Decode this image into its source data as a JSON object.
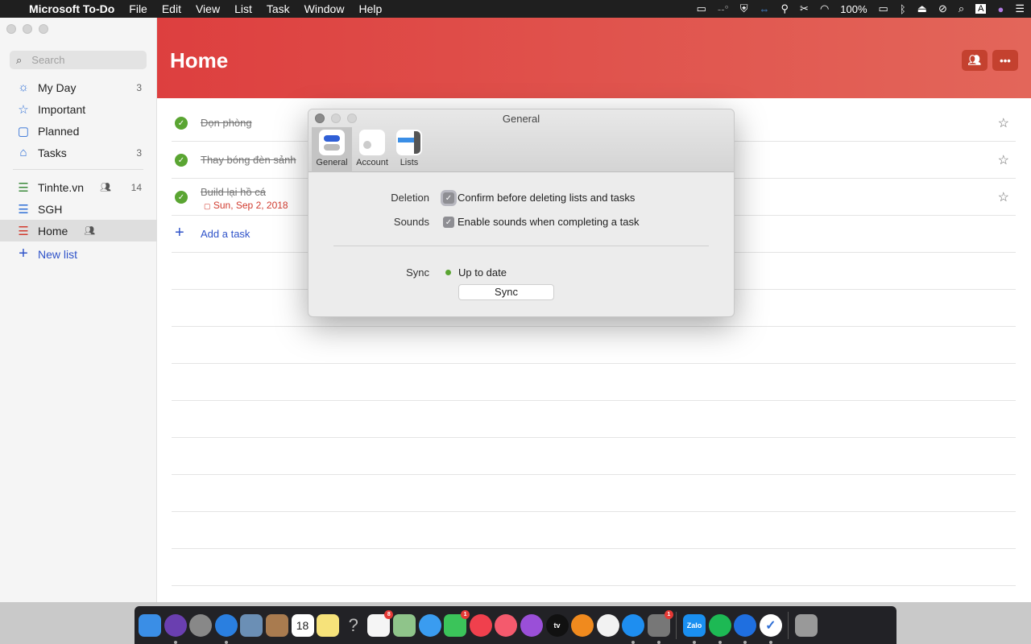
{
  "menubar": {
    "app": "Microsoft To-Do",
    "items": [
      "File",
      "Edit",
      "View",
      "List",
      "Task",
      "Window",
      "Help"
    ],
    "status": {
      "temp": "--°",
      "battery": "100%"
    }
  },
  "sidebar": {
    "search_placeholder": "Search",
    "smart": [
      {
        "label": "My Day",
        "count": "3",
        "icon": "sun-icon"
      },
      {
        "label": "Important",
        "count": "",
        "icon": "star-icon"
      },
      {
        "label": "Planned",
        "count": "",
        "icon": "calendar-icon"
      },
      {
        "label": "Tasks",
        "count": "3",
        "icon": "home-check-icon"
      }
    ],
    "lists": [
      {
        "label": "Tinhte.vn",
        "count": "14",
        "shared": true,
        "color": "#3a8a3a"
      },
      {
        "label": "SGH",
        "count": "",
        "shared": false,
        "color": "#2f6fd6"
      },
      {
        "label": "Home",
        "count": "",
        "shared": true,
        "color": "#d13b2f",
        "selected": true
      }
    ],
    "new_list": "New list"
  },
  "main": {
    "title": "Home",
    "tasks": [
      {
        "title": "Dọn phòng",
        "done": true
      },
      {
        "title": "Thay bóng đèn sảnh",
        "done": true
      },
      {
        "title": "Build lại hồ cá",
        "done": true,
        "due": "Sun, Sep 2, 2018"
      }
    ],
    "add_task": "Add a task"
  },
  "dialog": {
    "title": "General",
    "tabs": [
      "General",
      "Account",
      "Lists"
    ],
    "deletion_label": "Deletion",
    "deletion_option": "Confirm before deleting lists and tasks",
    "deletion_checked": true,
    "sounds_label": "Sounds",
    "sounds_option": "Enable sounds when completing a task",
    "sounds_checked": true,
    "sync_label": "Sync",
    "sync_status": "Up to date",
    "sync_button": "Sync",
    "sync_color": "#5aa532"
  },
  "dock": [
    {
      "name": "finder",
      "color": "#3a8ee6"
    },
    {
      "name": "siri",
      "color": "#6a3fb0",
      "round": true,
      "dot": true
    },
    {
      "name": "launchpad",
      "color": "#888",
      "round": true
    },
    {
      "name": "safari",
      "color": "#2a7fe0",
      "round": true,
      "dot": true
    },
    {
      "name": "mail-eagle",
      "color": "#6b8fb5"
    },
    {
      "name": "contacts",
      "color": "#a97b4f"
    },
    {
      "name": "calendar",
      "color": "#fff",
      "text": "18"
    },
    {
      "name": "notes",
      "color": "#f6e27a"
    },
    {
      "name": "help",
      "color": "transparent",
      "text": "?"
    },
    {
      "name": "reminders",
      "color": "#f5f5f5",
      "badge": "8"
    },
    {
      "name": "maps",
      "color": "#8fc48a"
    },
    {
      "name": "messages",
      "color": "#3a9cf0",
      "round": true
    },
    {
      "name": "facetime",
      "color": "#3bc45a",
      "badge": "1"
    },
    {
      "name": "news",
      "color": "#f0404d",
      "round": true
    },
    {
      "name": "music",
      "color": "#f45a6d",
      "round": true
    },
    {
      "name": "podcasts",
      "color": "#9a4fd8",
      "round": true
    },
    {
      "name": "apple-tv",
      "color": "#111",
      "round": true,
      "text": "tv"
    },
    {
      "name": "books",
      "color": "#f08a1e",
      "round": true
    },
    {
      "name": "photos",
      "color": "#f2f2f2",
      "round": true
    },
    {
      "name": "app-store",
      "color": "#1e8ef0",
      "round": true,
      "dot": true
    },
    {
      "name": "system-preferences",
      "color": "#777",
      "badge": "1",
      "dot": true
    },
    {
      "sep": true
    },
    {
      "name": "zalo",
      "color": "#1a8ff0",
      "text": "Zalo",
      "dot": true
    },
    {
      "name": "spotify",
      "color": "#1db954",
      "round": true,
      "dot": true
    },
    {
      "name": "teamviewer",
      "color": "#1f6fe0",
      "round": true,
      "dot": true
    },
    {
      "name": "microsoft-to-do",
      "color": "#fff",
      "round": true,
      "dot": true
    },
    {
      "sep": true
    },
    {
      "name": "trash",
      "color": "#999"
    }
  ]
}
